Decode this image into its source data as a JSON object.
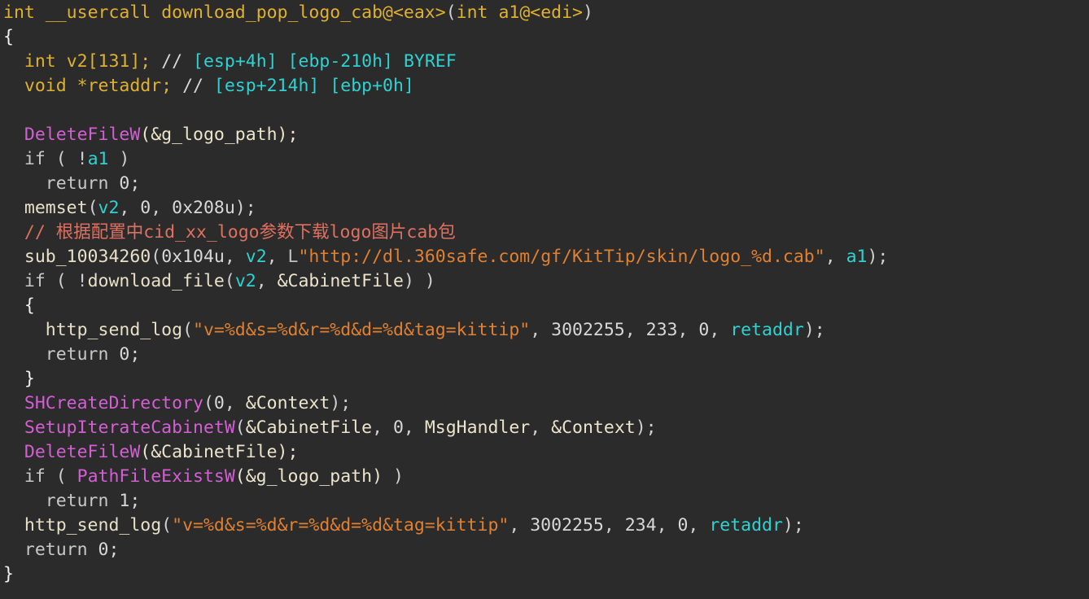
{
  "view": {
    "name": "hex-rays-pseudocode",
    "background": "#2b2b2b",
    "function_name": "download_pop_logo_cab"
  },
  "colors": {
    "background": "#2b2b2b",
    "keyword": "#e0b030",
    "flow_keyword": "#c8c8c8",
    "register_var": "#2fd1d1",
    "api_function": "#d45fd4",
    "user_function": "#e8e0c8",
    "string_literal": "#e08030",
    "chinese_comment": "#e07060",
    "stack_comment": "#2fd1d1",
    "number": "#d8d8d8",
    "punctuation": "#d0d0d0"
  },
  "code": {
    "line01": {
      "kw_int": "int",
      "kw_usercall": "__usercall",
      "fn_name": "download_pop_logo_cab@<eax>",
      "open_paren": "(",
      "arg_type": "int",
      "arg_name": "a1@<edi>",
      "close_paren": ")"
    },
    "line02": {
      "brace": "{"
    },
    "line03": {
      "kw": "int",
      "var": "v2[131];",
      "slashes": "//",
      "stack1": "[esp+4h]",
      "stack2": "[ebp-210h]",
      "byref": "BYREF"
    },
    "line04": {
      "kw": "void",
      "var": "*retaddr;",
      "slashes": "//",
      "stack1": "[esp+214h]",
      "stack2": "[ebp+0h]"
    },
    "line05": {
      "blank": ""
    },
    "line06": {
      "api": "DeleteFileW",
      "args": "(&g_logo_path);"
    },
    "line07": {
      "kw_if": "if",
      "open": "( ",
      "bang": "!",
      "var": "a1",
      "close": " )"
    },
    "line08": {
      "kw_return": "return",
      "value": "0;"
    },
    "line09": {
      "fn": "memset",
      "open": "(",
      "arg1": "v2",
      "sep1": ", ",
      "arg2": "0",
      "sep2": ", ",
      "arg3": "0x208u",
      "close": ");"
    },
    "line10": {
      "comment": "// 根据配置中cid_xx_logo参数下载logo图片cab包"
    },
    "line11": {
      "fn": "sub_10034260",
      "open": "(",
      "arg1": "0x104u",
      "sep1": ", ",
      "arg2": "v2",
      "sep2": ", ",
      "prefix": "L",
      "str": "\"http://dl.360safe.com/gf/KitTip/skin/logo_%d.cab\"",
      "sep3": ", ",
      "arg3": "a1",
      "close": ");"
    },
    "line12": {
      "kw_if": "if",
      "open": "( ",
      "bang": "!",
      "fn": "download_file",
      "args_open": "(",
      "arg1": "v2",
      "sep": ", ",
      "arg2": "&CabinetFile",
      "args_close": ")",
      "close": " )"
    },
    "line13": {
      "brace": "{"
    },
    "line14": {
      "fn": "http_send_log",
      "open": "(",
      "str": "\"v=%d&s=%d&r=%d&d=%d&tag=kittip\"",
      "sep1": ", ",
      "num1": "3002255",
      "sep2": ", ",
      "num2": "233",
      "sep3": ", ",
      "num3": "0",
      "sep4": ", ",
      "arg": "retaddr",
      "close": ");"
    },
    "line15": {
      "kw_return": "return",
      "value": "0;"
    },
    "line16": {
      "brace": "}"
    },
    "line17": {
      "api": "SHCreateDirectory",
      "open": "(",
      "arg1": "0",
      "sep": ", ",
      "arg2": "&Context",
      "close": ");"
    },
    "line18": {
      "api": "SetupIterateCabinetW",
      "open": "(",
      "arg1": "&CabinetFile",
      "sep1": ", ",
      "arg2": "0",
      "sep2": ", ",
      "arg3": "MsgHandler",
      "sep3": ", ",
      "arg4": "&Context",
      "close": ");"
    },
    "line19": {
      "api": "DeleteFileW",
      "args": "(&CabinetFile);"
    },
    "line20": {
      "kw_if": "if",
      "open": "( ",
      "api": "PathFileExistsW",
      "args": "(&g_logo_path)",
      "close": " )"
    },
    "line21": {
      "kw_return": "return",
      "value": "1;"
    },
    "line22": {
      "fn": "http_send_log",
      "open": "(",
      "str": "\"v=%d&s=%d&r=%d&d=%d&tag=kittip\"",
      "sep1": ", ",
      "num1": "3002255",
      "sep2": ", ",
      "num2": "234",
      "sep3": ", ",
      "num3": "0",
      "sep4": ", ",
      "arg": "retaddr",
      "close": ");"
    },
    "line23": {
      "kw_return": "return",
      "value": "0;"
    },
    "line24": {
      "brace": "}"
    }
  }
}
